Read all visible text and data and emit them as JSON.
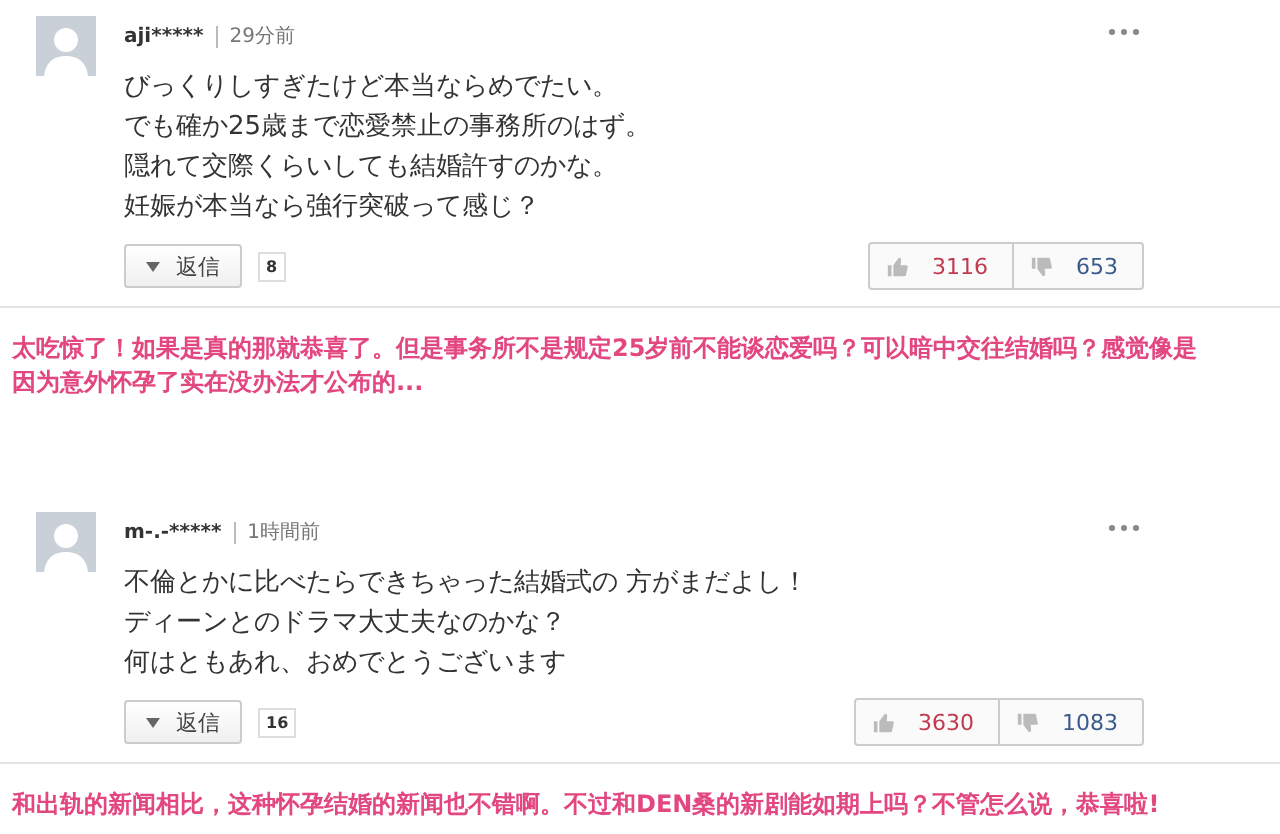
{
  "comments": [
    {
      "user": "aji*****",
      "time": "29分前",
      "lines": [
        "びっくりしすぎたけど本当ならめでたい。",
        "でも確か25歳まで恋愛禁止の事務所のはず。",
        "隠れて交際くらいしても結婚許すのかな。",
        "妊娠が本当なら強行突破って感じ？"
      ],
      "reply_label": "返信",
      "reply_count": "8",
      "likes": "3116",
      "dislikes": "653",
      "translation": "太吃惊了！如果是真的那就恭喜了。但是事务所不是规定25岁前不能谈恋爱吗？可以暗中交往结婚吗？感觉像是因为意外怀孕了实在没办法才公布的..."
    },
    {
      "user": "m-.-*****",
      "time": "1時間前",
      "lines": [
        "不倫とかに比べたらできちゃった結婚式の 方がまだよし！",
        "ディーンとのドラマ大丈夫なのかな？",
        "何はともあれ、おめでとうございます"
      ],
      "reply_label": "返信",
      "reply_count": "16",
      "likes": "3630",
      "dislikes": "1083",
      "translation": "和出轨的新闻相比，这种怀孕结婚的新闻也不错啊。不过和DEN桑的新剧能如期上吗？不管怎么说，恭喜啦!"
    }
  ]
}
